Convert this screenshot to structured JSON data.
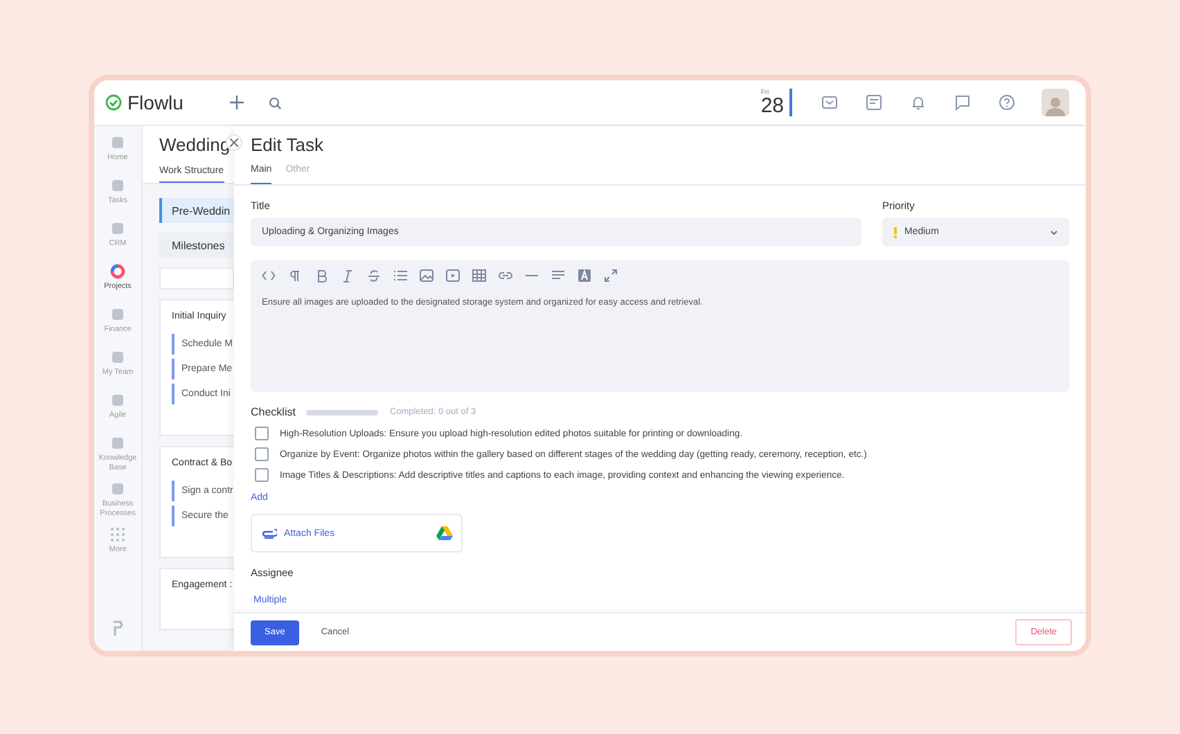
{
  "app": {
    "name": "Flowlu"
  },
  "sidebar": {
    "items": [
      {
        "label": "Home",
        "selected": false
      },
      {
        "label": "Tasks",
        "selected": false
      },
      {
        "label": "CRM",
        "selected": false
      },
      {
        "label": "Projects",
        "selected": true
      },
      {
        "label": "Finance",
        "selected": false
      },
      {
        "label": "My Team",
        "selected": false
      },
      {
        "label": "Agile",
        "selected": false
      },
      {
        "label": "Knowledge Base",
        "selected": false
      },
      {
        "label": "Business Processes",
        "selected": false
      },
      {
        "label": "More",
        "selected": false
      }
    ]
  },
  "topbar": {
    "date": {
      "weekday": "Fri",
      "day": "28"
    }
  },
  "project": {
    "title": "Wedding",
    "tabs": [
      {
        "label": "Work Structure",
        "selected": true
      }
    ],
    "stages": [
      {
        "label": "Pre-Weddin",
        "selected": true
      },
      {
        "label": "Milestones",
        "selected": false
      }
    ],
    "groups": [
      {
        "title": "Initial Inquiry",
        "tasks": [
          "Schedule M",
          "Prepare Me",
          "Conduct Ini"
        ]
      },
      {
        "title": "Contract & Bo",
        "tasks": [
          "Sign a contr",
          "Secure the"
        ]
      },
      {
        "title": "Engagement :"
      }
    ]
  },
  "drawer": {
    "title": "Edit Task",
    "tabs": [
      {
        "label": "Main",
        "selected": true
      },
      {
        "label": "Other",
        "selected": false
      }
    ],
    "title_field": {
      "label": "Title",
      "value": "Uploading & Organizing Images"
    },
    "priority": {
      "label": "Priority",
      "value": "Medium",
      "color": "#f5c518"
    },
    "description": "Ensure all images are uploaded to the designated storage system and organized for easy access and retrieval.",
    "checklist": {
      "label": "Checklist",
      "level": 0,
      "progress_text": "Completed: 0 out of 3",
      "items": [
        {
          "text": "High-Resolution Uploads: Ensure you upload high-resolution edited photos suitable for printing or downloading.",
          "checked": false
        },
        {
          "text": "Organize by Event: Organize photos within the gallery based on different stages of the wedding day (getting ready, ceremony, reception, etc.)",
          "checked": false
        },
        {
          "text": "Image Titles & Descriptions: Add descriptive titles and captions to each image, providing context and enhancing the viewing experience.",
          "checked": false
        }
      ],
      "add_link": "Add"
    },
    "attach": "Attach Files",
    "assignee": {
      "label": "Assignee",
      "value": "Multiple"
    },
    "buttons": {
      "save": "Save",
      "cancel": "Cancel",
      "delete": "Delete"
    }
  }
}
